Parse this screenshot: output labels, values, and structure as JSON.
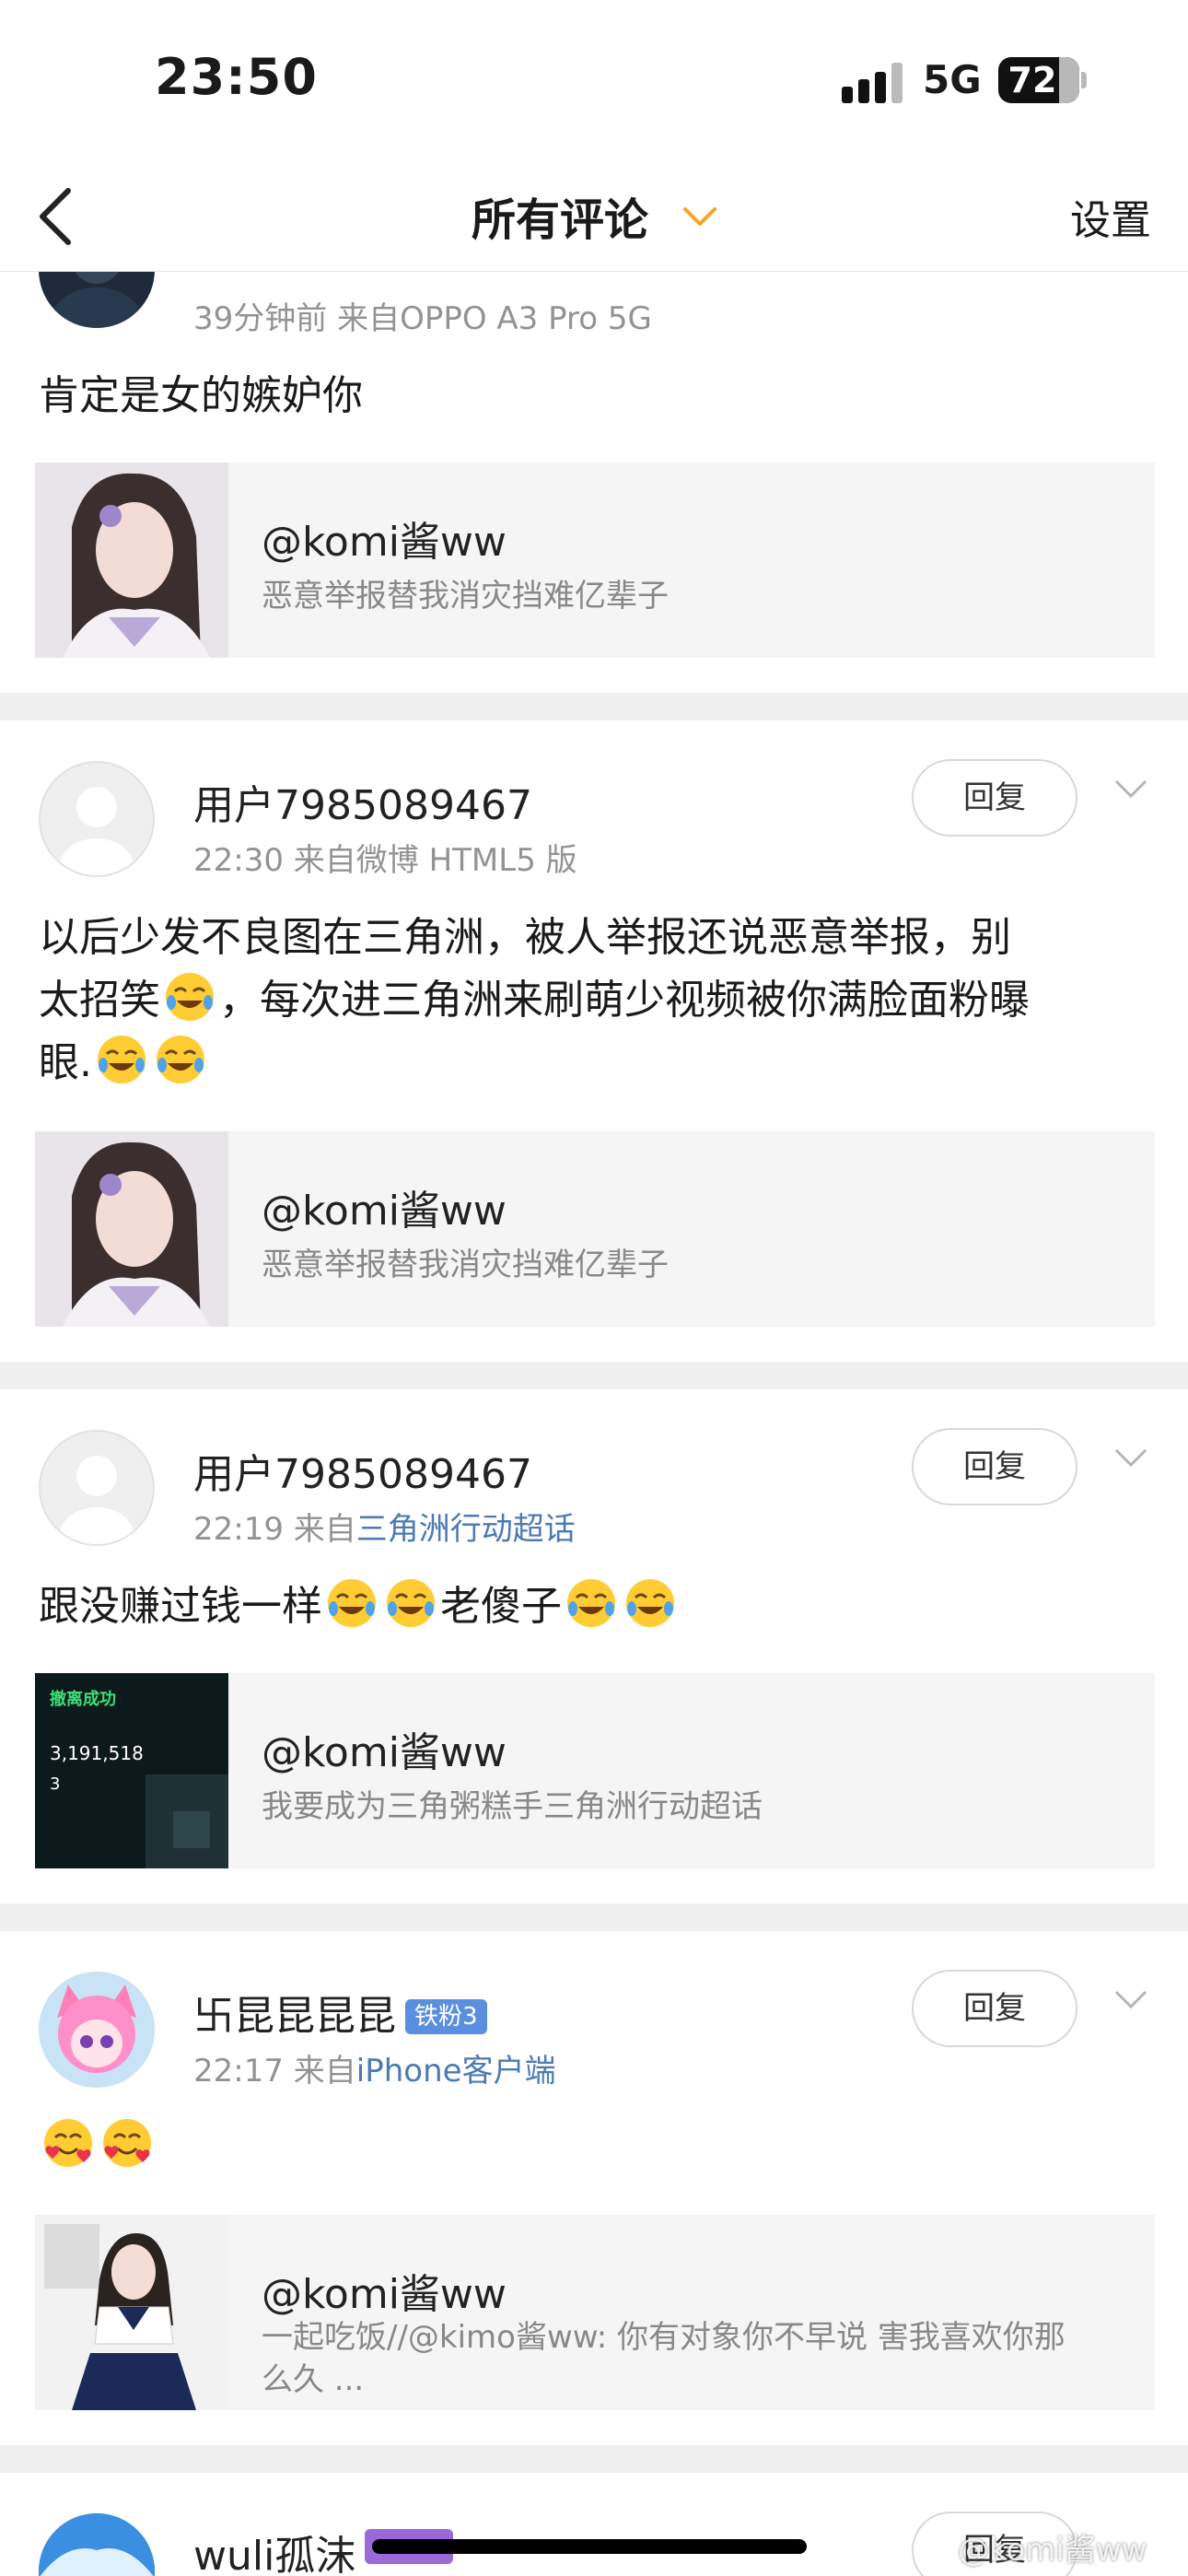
{
  "status": {
    "time": "23:50",
    "network": "5G",
    "battery": "72"
  },
  "nav": {
    "title": "所有评论",
    "settings": "设置"
  },
  "comments": [
    {
      "meta": "39分钟前  来自OPPO A3 Pro 5G",
      "text": "肯定是女的嫉妒你",
      "card": {
        "title": "@komi酱ww",
        "subtitle": "恶意举报替我消灾挡难亿辈子"
      }
    },
    {
      "user": "用户7985089467",
      "meta": "22:30  来自微博 HTML5 版",
      "reply": "回复",
      "text_1": "以后少发不良图在三角洲，被人举报还说恶意举报，别",
      "text_2": "太招笑",
      "text_3": "，每次进三角洲来刷萌少视频被你满脸面粉曝",
      "text_4": "眼.",
      "card": {
        "title": "@komi酱ww",
        "subtitle": "恶意举报替我消灾挡难亿辈子"
      }
    },
    {
      "user": "用户7985089467",
      "meta_prefix": "22:19  来自",
      "meta_link": "三角洲行动超话",
      "reply": "回复",
      "text_1": "跟没赚过钱一样",
      "text_2": "老傻子",
      "card": {
        "title": "@komi酱ww",
        "subtitle": "我要成为三角粥糕手三角洲行动超话",
        "thumb_heading": "撤离成功",
        "thumb_value": "3,191,518",
        "thumb_count": "3"
      }
    },
    {
      "user": "卐昆昆昆昆",
      "badge": "铁粉3",
      "meta_prefix": "22:17  来自",
      "meta_link": "iPhone客户端",
      "reply": "回复",
      "card": {
        "title": "@komi酱ww",
        "subtitle_1": "一起吃饭//@kimo酱ww: 你有对象你不早说 害我喜欢你那",
        "subtitle_2": "么久 ..."
      }
    },
    {
      "user": "wuli孤沫",
      "reply": "回复"
    }
  ],
  "watermark": "@komi酱ww",
  "colors": {
    "link": "#4b7ab5",
    "accent": "#f5a623",
    "badge": "#5a8fe0",
    "badge_purple": "#9c6ad8"
  },
  "icons": [
    "back-icon",
    "chevron-down-icon",
    "laughing-emoji-icon",
    "smiling-hearts-emoji-icon"
  ]
}
